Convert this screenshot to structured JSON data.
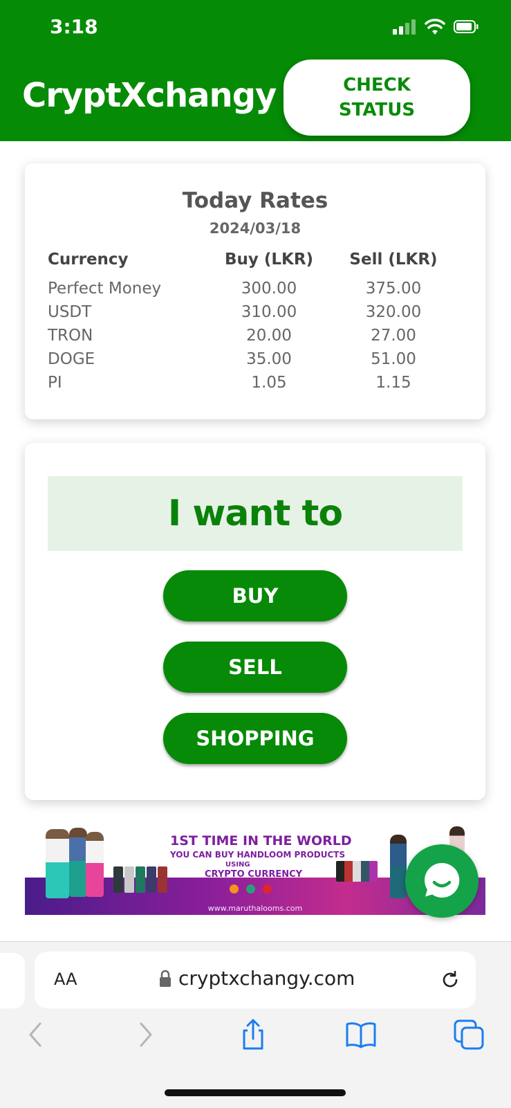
{
  "status_bar": {
    "time": "3:18"
  },
  "header": {
    "title": "CryptXchangy",
    "check_status_line1": "CHECK",
    "check_status_line2": "STATUS",
    "color": "#068b06"
  },
  "rates": {
    "title": "Today Rates",
    "date": "2024/03/18",
    "columns": [
      "Currency",
      "Buy (LKR)",
      "Sell (LKR)"
    ],
    "rows": [
      [
        "Perfect Money",
        "300.00",
        "375.00"
      ],
      [
        "USDT",
        "310.00",
        "320.00"
      ],
      [
        "TRON",
        "20.00",
        "27.00"
      ],
      [
        "DOGE",
        "35.00",
        "51.00"
      ],
      [
        "PI",
        "1.05",
        "1.15"
      ]
    ]
  },
  "action": {
    "heading": "I want to",
    "buy_label": "BUY",
    "sell_label": "SELL",
    "shopping_label": "SHOPPING"
  },
  "ad": {
    "line1": "1ST TIME IN THE WORLD",
    "line2": "YOU CAN BUY HANDLOOM PRODUCTS",
    "line3": "USING",
    "line4": "CRYPTO CURRENCY",
    "url": "www.maruthalooms.com"
  },
  "browser": {
    "aa_label": "AA",
    "url": "cryptxchangy.com"
  },
  "icons": {
    "chat": "chat-bubble-icon",
    "lock": "lock-icon",
    "reload": "reload-icon",
    "back": "back-arrow-icon",
    "forward": "forward-arrow-icon",
    "share": "share-icon",
    "bookmarks": "book-icon",
    "tabs": "tabs-icon"
  }
}
